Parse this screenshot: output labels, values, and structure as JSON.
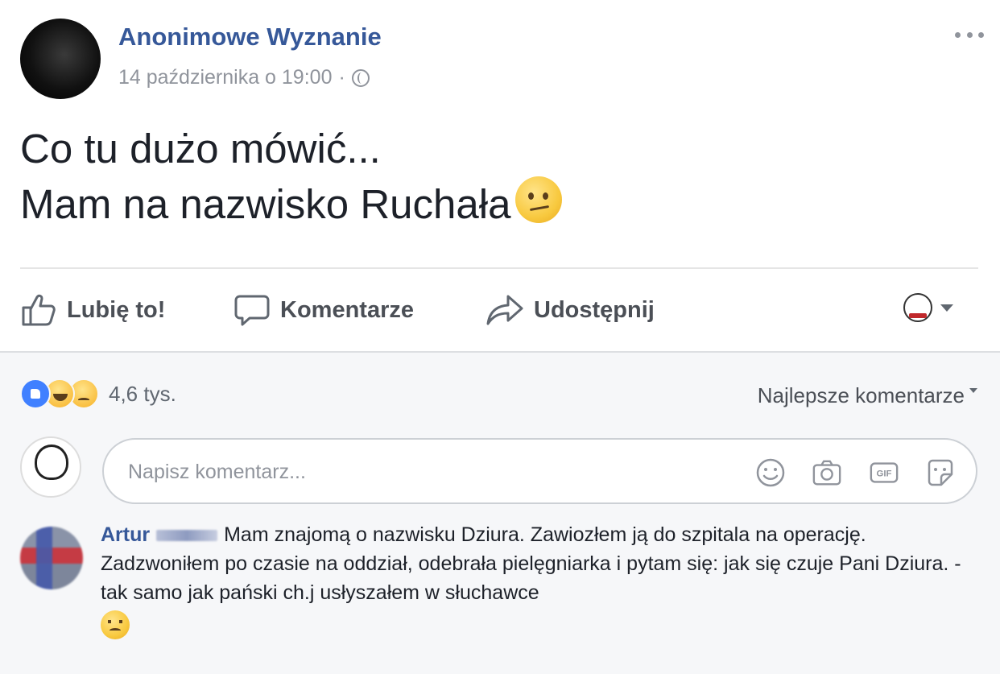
{
  "post": {
    "author": "Anonimowe Wyznanie",
    "timestamp": "14 października o 19:00",
    "separator": "·",
    "privacy_icon": "globe-icon",
    "text_line1": "Co tu dużo mówić...",
    "text_line2": "Mam na nazwisko Ruchała",
    "text_emoji": "confused-face-emoji"
  },
  "actions": {
    "like": "Lubię to!",
    "comment": "Komentarze",
    "share": "Udostępnij"
  },
  "reactions": {
    "types": [
      "like",
      "haha",
      "sad"
    ],
    "count": "4,6 tys."
  },
  "sort": {
    "label": "Najlepsze komentarze"
  },
  "comment_box": {
    "placeholder": "Napisz komentarz...",
    "icons": [
      "emoji-icon",
      "camera-icon",
      "gif-icon",
      "sticker-icon"
    ]
  },
  "comments": [
    {
      "author": "Artur",
      "text": "Mam znajomą o nazwisku Dziura. Zawiozłem ją do szpitala na operację. Zadzwoniłem po czasie na oddział, odebrała pielęgniarka i pytam się: jak się czuje Pani Dziura. - tak samo jak pański ch.j usłyszałem w słuchawce",
      "emoji": "sad-face-emoji"
    }
  ],
  "colors": {
    "link": "#365899",
    "meta": "#90949c",
    "action": "#4b4f56",
    "comments_bg": "#f6f7f9",
    "like_blue": "#4080ff"
  }
}
